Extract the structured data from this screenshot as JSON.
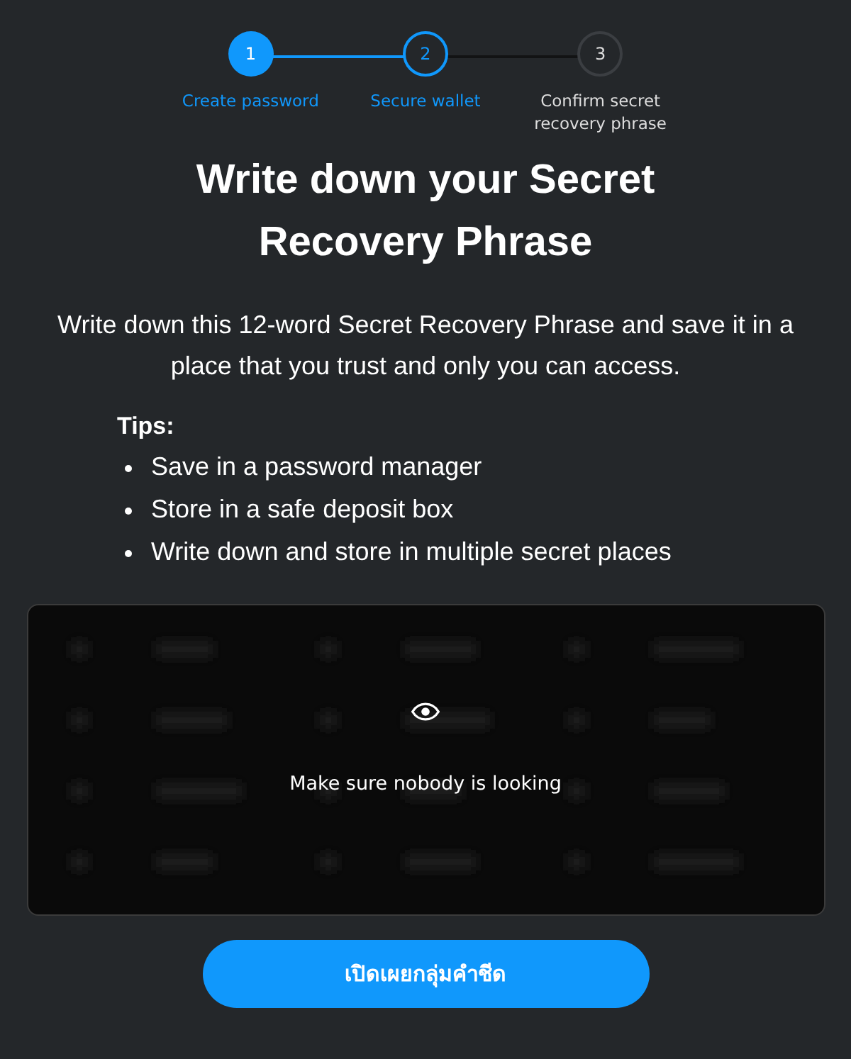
{
  "steps": [
    {
      "number": "1",
      "label": "Create password",
      "kind": "complete"
    },
    {
      "number": "2",
      "label": "Secure wallet",
      "kind": "current"
    },
    {
      "number": "3",
      "label": "Confirm secret recovery phrase",
      "kind": "upcoming"
    }
  ],
  "title": "Write down your Secret Recovery Phrase",
  "description": "Write down this 12-word Secret Recovery Phrase and save it in a place that you trust and only you can access.",
  "tips": {
    "heading": "Tips:",
    "items": [
      "Save in a password manager",
      "Store in a safe deposit box",
      "Write down and store in multiple secret places"
    ]
  },
  "phrase_box": {
    "warning": "Make sure nobody is looking"
  },
  "reveal_button": "เปิดเผยกลุ่มคำชีด"
}
